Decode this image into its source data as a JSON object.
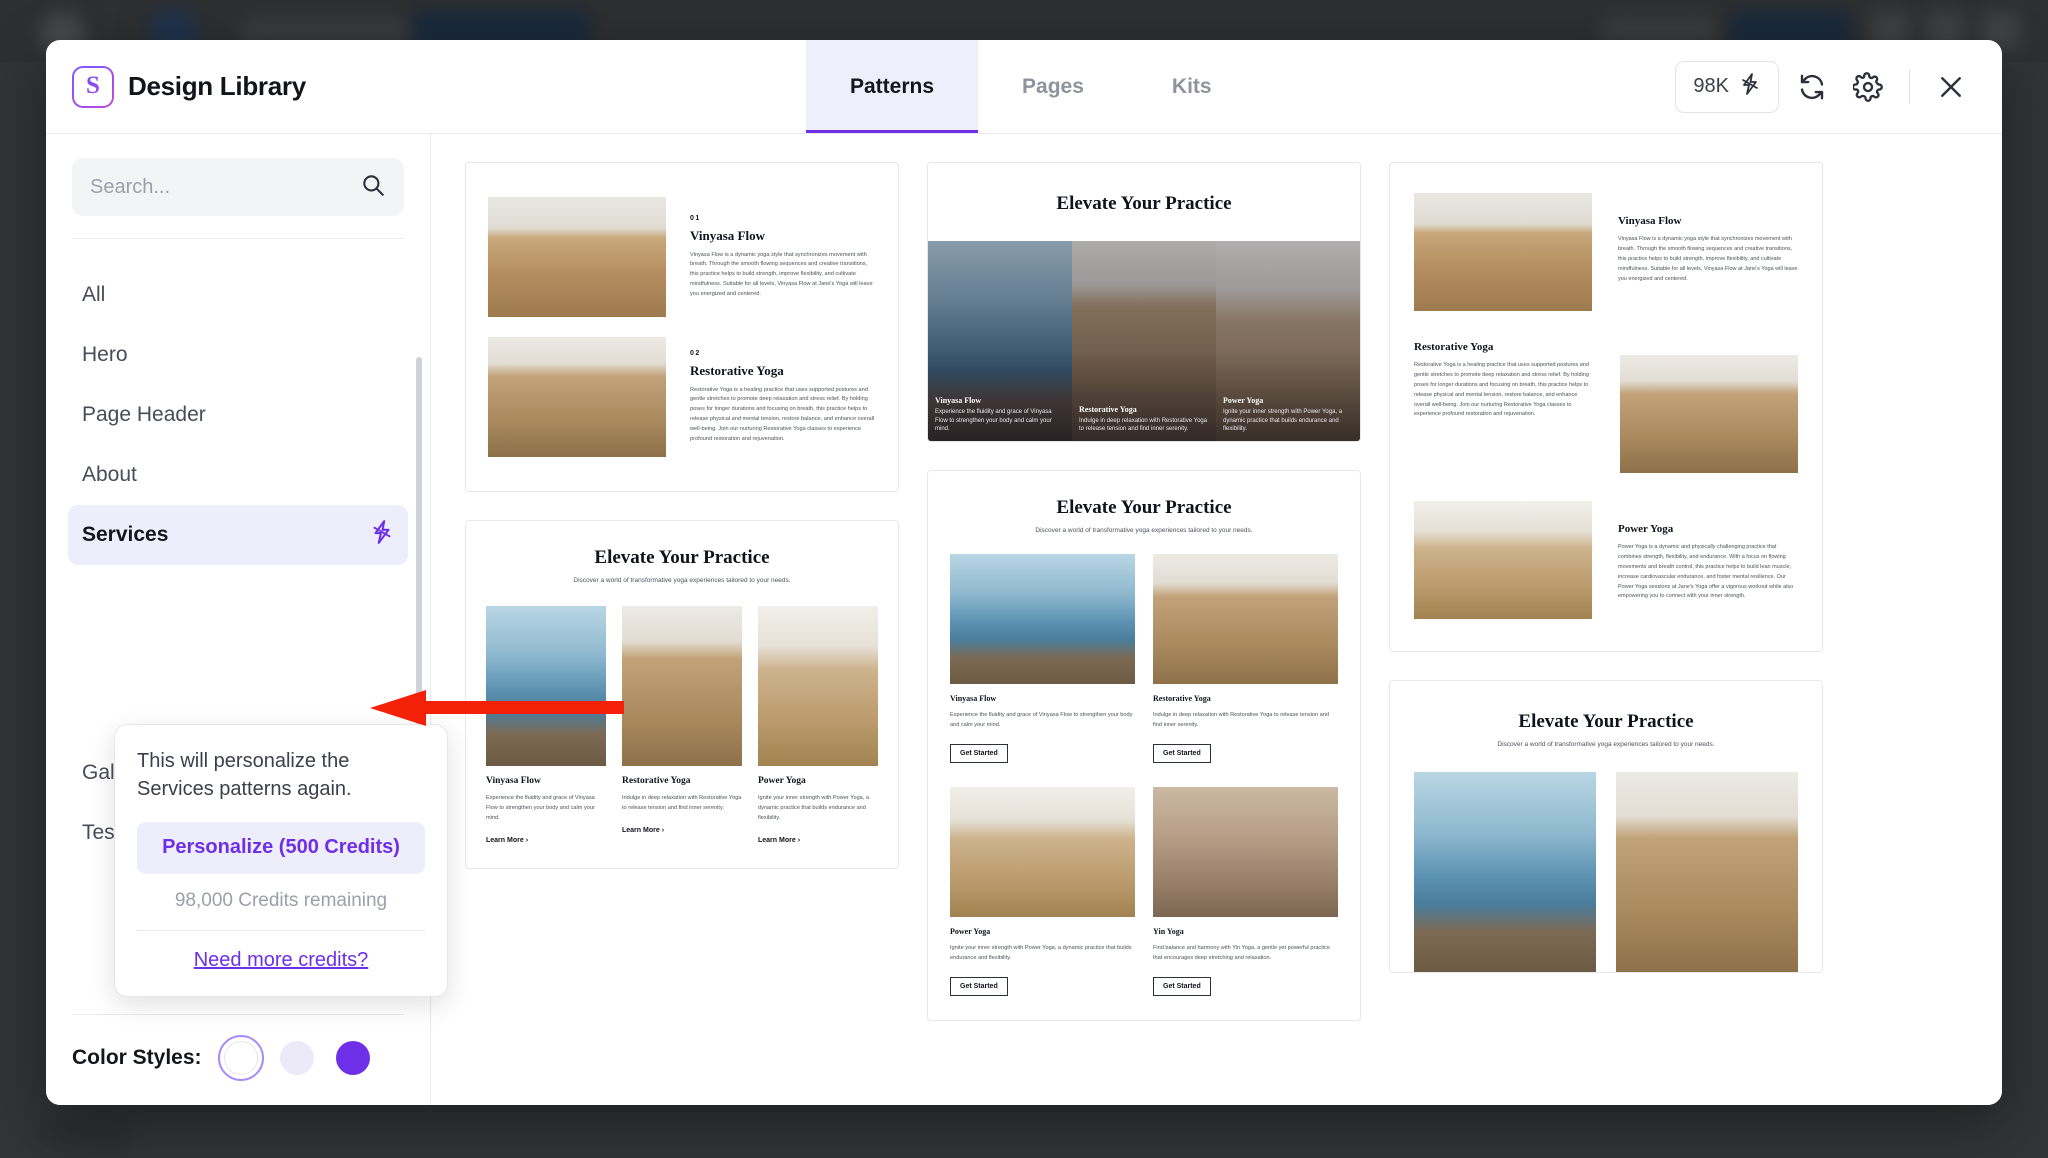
{
  "app": {
    "title": "Design Library",
    "logo_icon": "design-library-logo"
  },
  "header": {
    "tabs": [
      {
        "label": "Patterns",
        "active": true
      },
      {
        "label": "Pages",
        "active": false
      },
      {
        "label": "Kits",
        "active": false
      }
    ],
    "credits_badge": "98K",
    "credits_icon": "lightning-bolt-icon",
    "refresh_icon": "refresh-icon",
    "settings_icon": "gear-icon",
    "close_icon": "close-icon"
  },
  "sidebar": {
    "search": {
      "value": "",
      "placeholder": "Search...",
      "icon": "search-icon"
    },
    "items": [
      {
        "label": "All",
        "active": false,
        "bolt": false
      },
      {
        "label": "Hero",
        "active": false,
        "bolt": false
      },
      {
        "label": "Page Header",
        "active": false,
        "bolt": false
      },
      {
        "label": "About",
        "active": false,
        "bolt": false
      },
      {
        "label": "Services",
        "active": true,
        "bolt": true
      },
      {
        "label": "Gallery",
        "active": false,
        "bolt": false
      },
      {
        "label": "Testimonials",
        "active": false,
        "bolt": false
      }
    ],
    "color_styles": {
      "label": "Color Styles:",
      "swatches": [
        {
          "name": "white",
          "hex": "#ffffff",
          "selected": true
        },
        {
          "name": "lavender",
          "hex": "#eceaf8",
          "selected": false
        },
        {
          "name": "purple",
          "hex": "#6d2fe8",
          "selected": false
        }
      ]
    }
  },
  "popover": {
    "message": "This will personalize the Services patterns again.",
    "action_label": "Personalize (500 Credits)",
    "credits_remaining": "98,000 Credits remaining",
    "link_label": "Need more credits?"
  },
  "annotation": {
    "arrow": "red-left-arrow",
    "color": "#f42007"
  },
  "patterns": {
    "card1": {
      "items": [
        {
          "number": "01",
          "title": "Vinyasa Flow",
          "body": "Vinyasa Flow is a dynamic yoga style that synchronizes movement with breath. Through the smooth flowing sequences and creative transitions, this practice helps to build strength, improve flexibility, and cultivate mindfulness. Suitable for all levels, Vinyasa Flow at Jane's Yoga will leave you energized and centered.",
          "image": "yoga-studio-seated-photo"
        },
        {
          "number": "02",
          "title": "Restorative Yoga",
          "body": "Restorative Yoga is a healing practice that uses supported postures and gentle stretches to promote deep relaxation and stress relief. By holding poses for longer durations and focusing on breath, this practice helps to release physical and mental tension, restore balance, and enhance overall well-being. Join our nurturing Restorative Yoga classes to experience profound restoration and rejuvenation.",
          "image": "yoga-forward-fold-photo"
        }
      ]
    },
    "card2": {
      "heading": "Elevate Your Practice",
      "tiles": [
        {
          "title": "Vinyasa Flow",
          "desc": "Experience the fluidity and grace of Vinyasa Flow to strengthen your body and calm your mind.",
          "image": "cliff-yoga-photo"
        },
        {
          "title": "Restorative Yoga",
          "desc": "Indulge in deep relaxation with Restorative Yoga to release tension and find inner serenity.",
          "image": "studio-stretch-photo"
        },
        {
          "title": "Power Yoga",
          "desc": "Ignite your inner strength with Power Yoga, a dynamic practice that builds endurance and flexibility.",
          "image": "studio-fold-photo"
        }
      ]
    },
    "card3": {
      "items": [
        {
          "title": "Vinyasa Flow",
          "body": "Vinyasa Flow is a dynamic yoga style that synchronizes movement with breath. Through the smooth flowing sequences and creative transitions, this practice helps to build strength, improve flexibility, and cultivate mindfulness. Suitable for all levels, Vinyasa Flow at Jane's Yoga will leave you energized and centered.",
          "image": "yoga-studio-seated-photo"
        },
        {
          "title": "Restorative Yoga",
          "body": "Restorative Yoga is a healing practice that uses supported postures and gentle stretches to promote deep relaxation and stress relief. By holding poses for longer durations and focusing on breath, this practice helps to release physical and mental tension, restore balance, and enhance overall well-being. Join our nurturing Restorative Yoga classes to experience profound restoration and rejuvenation.",
          "image": "yoga-forward-fold-photo"
        },
        {
          "title": "Power Yoga",
          "body": "Power Yoga is a dynamic and physically challenging practice that combines strength, flexibility, and endurance. With a focus on flowing movements and breath control, this practice helps to build lean muscle, increase cardiovascular endurance, and foster mental resilience. Our Power Yoga sessions at Jane's Yoga offer a vigorous workout while also empowering you to connect with your inner strength.",
          "image": "studio-fold-photo"
        }
      ]
    },
    "card4": {
      "heading": "Elevate Your Practice",
      "subheading": "Discover a world of transformative yoga experiences tailored to your needs.",
      "cards": [
        {
          "title": "Vinyasa Flow",
          "desc": "Experience the fluidity and grace of Vinyasa Flow to strengthen your body and calm your mind.",
          "cta": "Learn More",
          "image": "cliff-yoga-photo"
        },
        {
          "title": "Restorative Yoga",
          "desc": "Indulge in deep relaxation with Restorative Yoga to release tension and find inner serenity.",
          "cta": "Learn More",
          "image": "studio-stretch-photo"
        },
        {
          "title": "Power Yoga",
          "desc": "Ignite your inner strength with Power Yoga, a dynamic practice that builds endurance and flexibility.",
          "cta": "Learn More",
          "image": "studio-fold-photo"
        }
      ]
    },
    "card5": {
      "heading": "Elevate Your Practice",
      "subheading": "Discover a world of transformative yoga experiences tailored to your needs.",
      "cards": [
        {
          "title": "Vinyasa Flow",
          "desc": "Experience the fluidity and grace of Vinyasa Flow to strengthen your body and calm your mind.",
          "cta": "Get Started",
          "image": "cliff-yoga-photo"
        },
        {
          "title": "Restorative Yoga",
          "desc": "Indulge in deep relaxation with Restorative Yoga to release tension and find inner serenity.",
          "cta": "Get Started",
          "image": "studio-stretch-photo"
        },
        {
          "title": "Power Yoga",
          "desc": "Ignite your inner strength with Power Yoga, a dynamic practice that builds endurance and flexibility.",
          "cta": "Get Started",
          "image": "studio-fold-photo"
        },
        {
          "title": "Yin Yoga",
          "desc": "Find balance and harmony with Yin Yoga, a gentle yet powerful practice that encourages deep stretching and relaxation.",
          "cta": "Get Started",
          "image": "meditation-group-photo"
        }
      ]
    },
    "card6": {
      "heading": "Elevate Your Practice",
      "subheading": "Discover a world of transformative yoga experiences tailored to your needs.",
      "images": [
        "cliff-yoga-photo",
        "studio-stretch-photo"
      ]
    }
  }
}
